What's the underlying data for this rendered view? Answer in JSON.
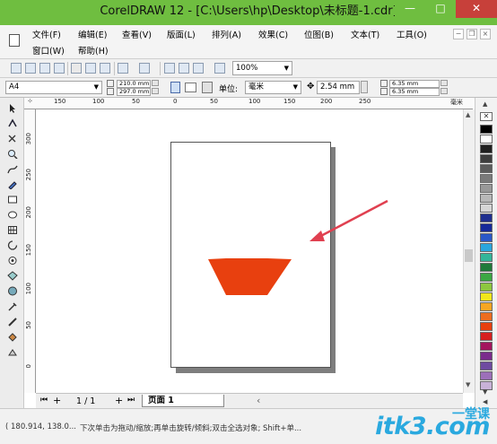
{
  "window": {
    "title": "CorelDRAW 12 - [C:\\Users\\hp\\Desktop\\未标题-1.cdr]",
    "controls": {
      "minimize": "—",
      "maximize": "□",
      "close": "✕"
    }
  },
  "menubar": {
    "items": [
      "文件(F)",
      "编辑(E)",
      "查看(V)",
      "版面(L)",
      "排列(A)",
      "效果(C)",
      "位图(B)",
      "文本(T)",
      "工具(O)",
      "窗口(W)",
      "帮助(H)"
    ],
    "mdi_controls": {
      "minimize": "−",
      "restore": "❐",
      "close": "×"
    }
  },
  "toolbar": {
    "zoom_level": "100%",
    "icons": [
      "new-icon",
      "open-icon",
      "save-icon",
      "print-icon",
      "cut-icon",
      "copy-icon",
      "paste-icon",
      "undo-icon",
      "redo-icon",
      "import-icon",
      "export-icon",
      "app-launcher-icon",
      "corel-online-icon"
    ]
  },
  "property_bar": {
    "page_size": "A4",
    "page_width": "210.0 mm",
    "page_height": "297.0 mm",
    "units_label": "单位:",
    "units": "毫米",
    "nudge": "2.54 mm",
    "duplicate_x": "6.35 mm",
    "duplicate_y": "6.35 mm"
  },
  "rulers": {
    "horizontal_labels": [
      "150",
      "100",
      "50",
      "0",
      "50",
      "100",
      "150",
      "200",
      "250"
    ],
    "horizontal_unit": "毫米",
    "vertical_labels": [
      "300",
      "250",
      "200",
      "150",
      "100",
      "50",
      "0"
    ]
  },
  "canvas": {
    "shape": "hexagon",
    "shape_color": "#e8400f",
    "arrow_color": "#e04050"
  },
  "palette": {
    "colors": [
      "#000000",
      "#ffffff",
      "#1f1f1f",
      "#3d3d3d",
      "#5c5c5c",
      "#7a7a7a",
      "#999999",
      "#b8b8b8",
      "#d6d6d6",
      "#1f2f8f",
      "#162a9a",
      "#2a58c8",
      "#2aa6dd",
      "#34b59a",
      "#1f7a3a",
      "#3ca743",
      "#8dc63f",
      "#f1e61c",
      "#f6a623",
      "#ed6d1f",
      "#e8400f",
      "#d61f1f",
      "#a3155e",
      "#7a2b8c",
      "#6e4aa0",
      "#9c6fb9",
      "#c8b2d8"
    ]
  },
  "pagebar": {
    "page_count": "1 / 1",
    "page_tab": "页面 1"
  },
  "statusbar": {
    "coordinates": "( 180.914, 138.0...",
    "hint": "下次单击为拖动/缩放;再单击旋转/倾斜;双击全选对象; Shift+单..."
  },
  "watermark": {
    "text": "itk3.com",
    "subtext": "一堂课"
  }
}
